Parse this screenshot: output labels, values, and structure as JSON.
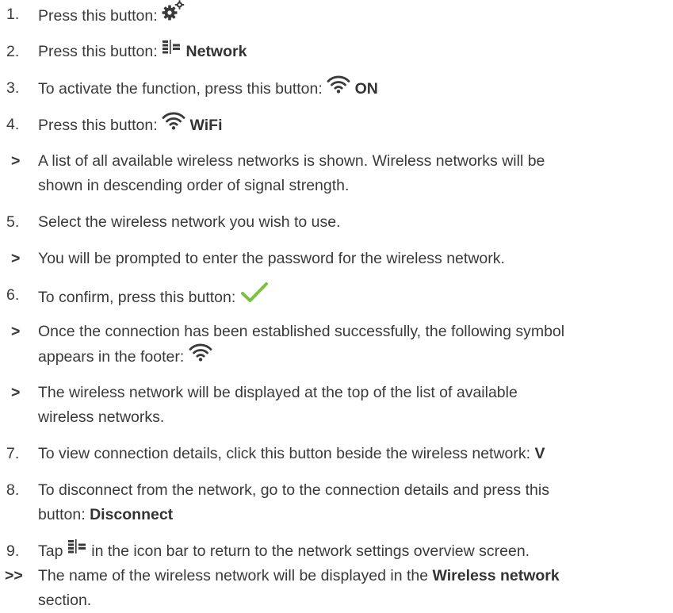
{
  "steps": [
    {
      "marker": "1.",
      "text": "Press this button:",
      "icon": "gear-icon"
    },
    {
      "marker": "2.",
      "text": "Press this button:",
      "icon": "network-settings-icon",
      "bold": "Network"
    },
    {
      "marker": "3.",
      "text": "To activate the function, press this button:",
      "icon": "wifi-icon",
      "bold": "ON"
    },
    {
      "marker": "4.",
      "text": "Press this button:",
      "icon": "wifi-icon",
      "bold": "WiFi"
    },
    {
      "marker": ">",
      "text": "A list of all available wireless networks is shown. Wireless networks will be",
      "text2": "shown in descending order of signal strength."
    },
    {
      "marker": "5.",
      "text": "Select the wireless network you wish to use."
    },
    {
      "marker": ">",
      "text": "You will be prompted to enter the password for the wireless network."
    },
    {
      "marker": "6.",
      "text": "To confirm, press this button:",
      "icon": "checkmark-icon"
    },
    {
      "marker": ">",
      "text": "Once the connection has been established successfully, the following symbol",
      "text2": "appears in the footer:",
      "icon": "wifi-icon"
    },
    {
      "marker": ">",
      "text": "The wireless network will be displayed at the top of the list of available",
      "text2": "wireless networks."
    },
    {
      "marker": "7.",
      "text": "To view connection details, click this button beside the wireless network:",
      "bold": "V"
    },
    {
      "marker": "8.",
      "text": "To disconnect from the network, go to the connection details and press this",
      "text2": "button:",
      "bold": "Disconnect"
    },
    {
      "marker": "9.",
      "text_before": "Tap",
      "text_after": "in the icon bar to return to the network settings overview screen.",
      "icon": "network-settings-icon"
    },
    {
      "marker": ">>",
      "text": "The name of the wireless network will be displayed in the",
      "bold": "Wireless network",
      "text2": "section."
    }
  ],
  "colors": {
    "text": "#3a3a3a",
    "check": "#7cc142"
  }
}
